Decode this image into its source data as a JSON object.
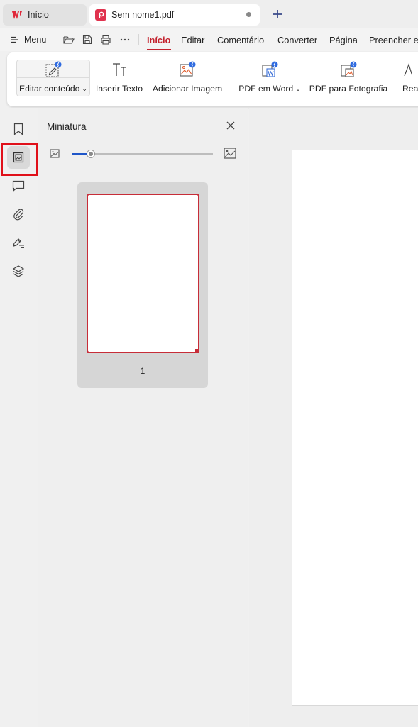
{
  "tabs": {
    "home_label": "Início",
    "doc_label": "Sem nome1.pdf"
  },
  "menubar": {
    "menu_label": "Menu",
    "tabs": [
      "Início",
      "Editar",
      "Comentário",
      "Converter",
      "Página",
      "Preencher e"
    ]
  },
  "ribbon": {
    "buttons": [
      "Editar conteúdo",
      "Inserir Texto",
      "Adicionar Imagem",
      "PDF em Word",
      "PDF para Fotografia",
      "Rea"
    ]
  },
  "panel": {
    "title": "Miniatura",
    "zoom_level": 0.13,
    "page_number": "1"
  },
  "colors": {
    "accent": "#c3212d",
    "highlight_box": "#e0101a",
    "slider": "#1f56c8"
  }
}
